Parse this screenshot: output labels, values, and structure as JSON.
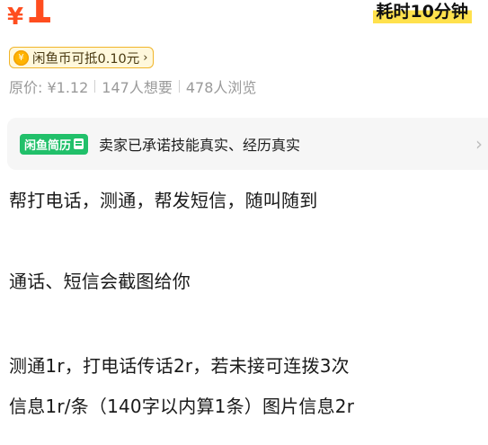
{
  "price": {
    "currency": "¥",
    "value": "1"
  },
  "duration_badge": "耗时10分钟",
  "coin_badge": {
    "icon": "coin-icon",
    "icon_glyph": "¥",
    "label": "闲鱼币可抵0.10元",
    "chevron": "›"
  },
  "meta": {
    "original_price": "原价: ¥1.12",
    "wants": "147人想要",
    "views": "478人浏览"
  },
  "resume_card": {
    "tag": "闲鱼简历",
    "text": "卖家已承诺技能真实、经历真实",
    "chevron": "›"
  },
  "description": [
    "帮打电话，测通，帮发短信，随叫随到",
    "通话、短信会截图给你",
    "测通1r，打电话传话2r，若未接可连拨3次",
    "信息1r/条（140字以内算1条）图片信息2r"
  ],
  "colors": {
    "price": "#ff4d1f",
    "highlight": "#ffe14d",
    "coin_border": "#f1b52a",
    "resume_tag": "#21c06a"
  }
}
